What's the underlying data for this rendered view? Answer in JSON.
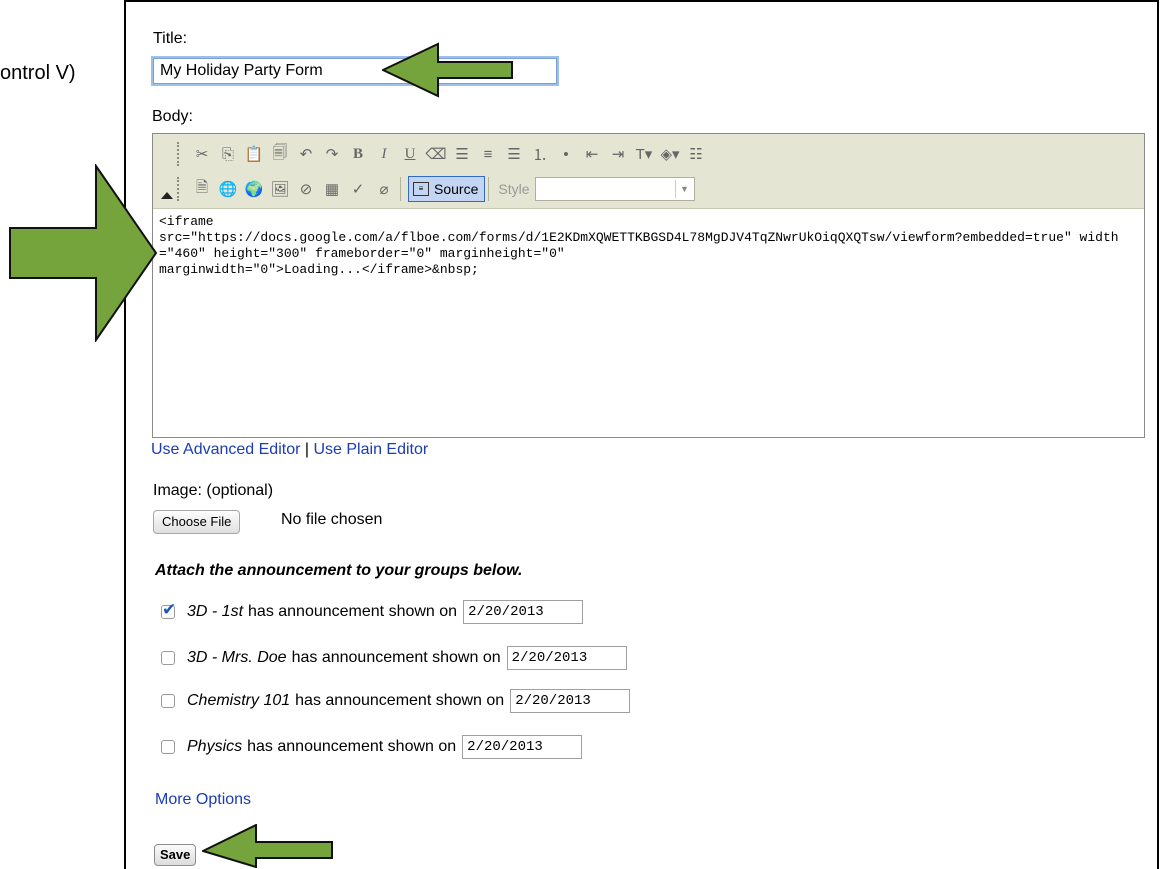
{
  "outside_note": "ontrol V)",
  "title_label": "Title:",
  "title_value": "My Holiday Party Form",
  "body_label": "Body:",
  "toolbar": {
    "source_label": "Source",
    "style_label": "Style",
    "style_value": ""
  },
  "body_code": "<iframe\nsrc=\"https://docs.google.com/a/flboe.com/forms/d/1E2KDmXQWETTKBGSD4L78MgDJV4TqZNwrUkOiqQXQTsw/viewform?embedded=true\" width=\"460\" height=\"300\" frameborder=\"0\" marginheight=\"0\"\nmarginwidth=\"0\">Loading...</iframe>&nbsp;",
  "editor_links": {
    "advanced": "Use Advanced Editor",
    "separator": "|",
    "plain": "Use Plain Editor"
  },
  "image_label": "Image: (optional)",
  "choose_file_label": "Choose File",
  "file_status": "No file chosen",
  "attach_heading": "Attach the announcement to your groups below.",
  "groups": [
    {
      "name": "3D - 1st",
      "suffix": "has announcement shown on",
      "date": "2/20/2013",
      "checked": true
    },
    {
      "name": "3D - Mrs. Doe",
      "suffix": "has announcement shown on",
      "date": "2/20/2013",
      "checked": false
    },
    {
      "name": "Chemistry 101",
      "suffix": "has announcement shown on",
      "date": "2/20/2013",
      "checked": false
    },
    {
      "name": "Physics",
      "suffix": "has announcement shown on",
      "date": "2/20/2013",
      "checked": false
    }
  ],
  "more_options": "More Options",
  "save_label": "Save",
  "colors": {
    "link": "#1a3cb5",
    "arrow_fill": "#75a43c",
    "toolbar_bg": "#e4e6d3",
    "focus_ring": "#9cc0ea"
  }
}
